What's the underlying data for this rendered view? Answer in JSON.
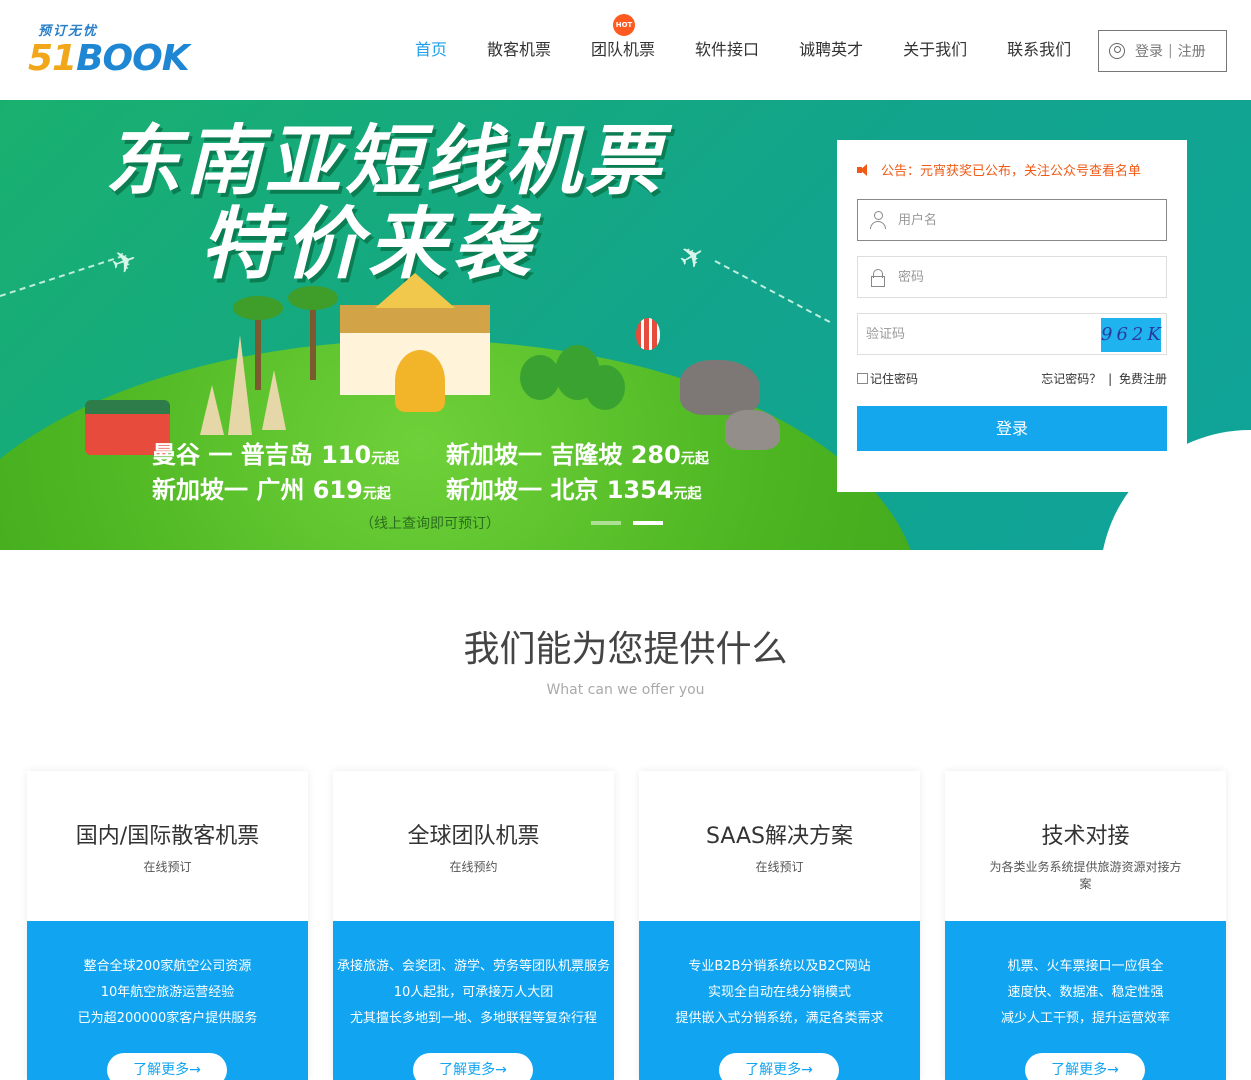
{
  "brand": {
    "slogan": "预订无忧",
    "num": "51",
    "name": "BOOK",
    "color_num": "#f2a71b",
    "color_name": "#1f86d4"
  },
  "nav": {
    "items": [
      {
        "label": "首页",
        "active": true
      },
      {
        "label": "散客机票"
      },
      {
        "label": "团队机票",
        "badge": "HOT"
      },
      {
        "label": "软件接口"
      },
      {
        "label": "诚聘英才"
      },
      {
        "label": "关于我们"
      },
      {
        "label": "联系我们"
      }
    ],
    "login": "登录",
    "sep": "|",
    "register": "注册",
    "accent": "#1ea0e9"
  },
  "banner": {
    "title_line1": "东南亚短线机票",
    "title_line2": "特价来袭",
    "routes": [
      {
        "route": "曼谷 一 普吉岛",
        "price": "110",
        "unit": "元起"
      },
      {
        "route": "新加坡一 吉隆坡",
        "price": "280",
        "unit": "元起"
      },
      {
        "route": "新加坡一 广州",
        "price": "619",
        "unit": "元起"
      },
      {
        "route": "新加坡一 北京",
        "price": "1354",
        "unit": "元起"
      }
    ],
    "note": "（线上查询即可预订）"
  },
  "login_panel": {
    "notice": "公告：元宵获奖已公布，关注公众号查看名单",
    "username_placeholder": "用户名",
    "password_placeholder": "密码",
    "captcha_placeholder": "验证码",
    "captcha_text": "962K",
    "remember": "记住密码",
    "forgot": "忘记密码？",
    "sep": "|",
    "free_register": "免费注册",
    "submit": "登录",
    "button_color": "#14a7ee",
    "notice_color": "#f05a16"
  },
  "offer": {
    "title": "我们能为您提供什么",
    "subtitle": "What can we offer you",
    "cards": [
      {
        "title": "国内/国际散客机票",
        "sub": "在线预订",
        "lines": [
          "整合全球200家航空公司资源",
          "10年航空旅游运营经验",
          "已为超200000家客户提供服务"
        ],
        "more": "了解更多→"
      },
      {
        "title": "全球团队机票",
        "sub": "在线预约",
        "lines": [
          "承接旅游、会奖团、游学、劳务等团队机票服务",
          "10人起批，可承接万人大团",
          "尤其擅长多地到一地、多地联程等复杂行程"
        ],
        "more": "了解更多→"
      },
      {
        "title": "SAAS解决方案",
        "sub": "在线预订",
        "lines": [
          "专业B2B分销系统以及B2C网站",
          "实现全自动在线分销模式",
          "提供嵌入式分销系统，满足各类需求"
        ],
        "more": "了解更多→"
      },
      {
        "title": "技术对接",
        "sub": "为各类业务系统提供旅游资源对接方案",
        "lines": [
          "机票、火车票接口一应俱全",
          "速度快、数据准、稳定性强",
          "减少人工干预，提升运营效率"
        ],
        "more": "了解更多→"
      }
    ]
  }
}
